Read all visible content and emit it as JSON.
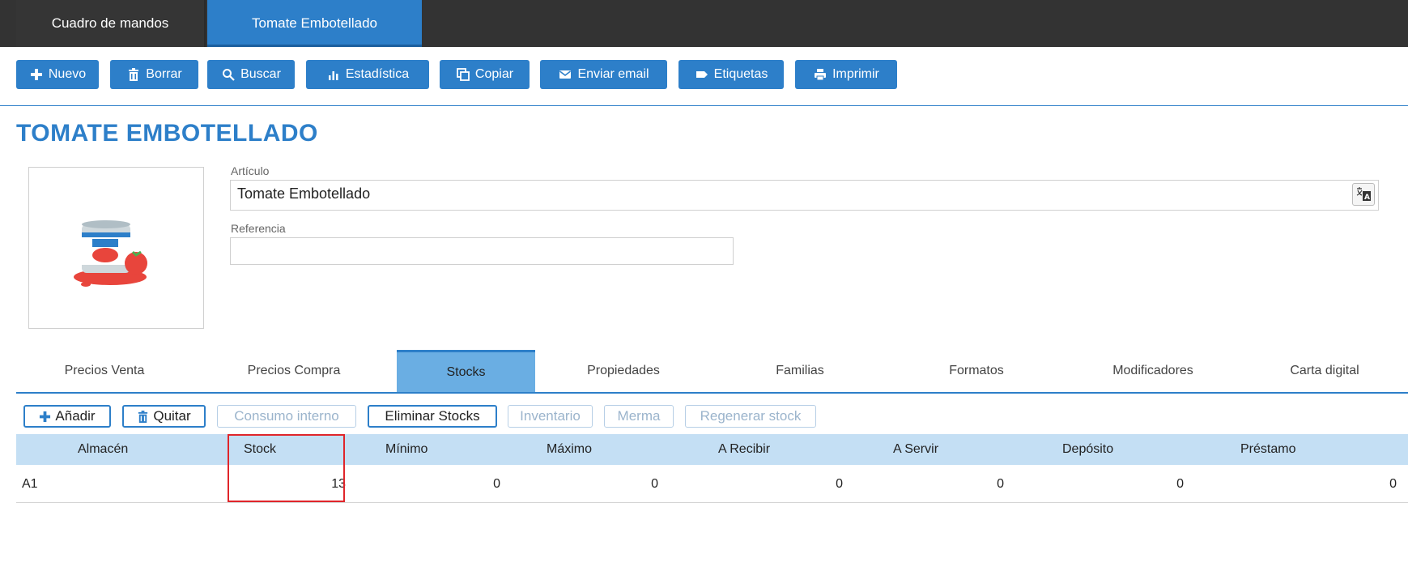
{
  "top_tabs": [
    {
      "label": "Cuadro de mandos"
    },
    {
      "label": "Tomate Embotellado"
    }
  ],
  "toolbar": {
    "nuevo": "Nuevo",
    "borrar": "Borrar",
    "buscar": "Buscar",
    "estadistica": "Estadística",
    "copiar": "Copiar",
    "enviar_email": "Enviar email",
    "etiquetas": "Etiquetas",
    "imprimir": "Imprimir"
  },
  "page_title": "TOMATE EMBOTELLADO",
  "product_image_icon": "tomato-soup-can-icon",
  "fields": {
    "articulo_label": "Artículo",
    "articulo_value": "Tomate Embotellado",
    "referencia_label": "Referencia",
    "referencia_value": ""
  },
  "section_tabs": [
    {
      "label": "Precios Venta"
    },
    {
      "label": "Precios Compra"
    },
    {
      "label": "Stocks"
    },
    {
      "label": "Propiedades"
    },
    {
      "label": "Familias"
    },
    {
      "label": "Formatos"
    },
    {
      "label": "Modificadores"
    },
    {
      "label": "Carta digital"
    }
  ],
  "active_section_tab": "Stocks",
  "stock_actions": {
    "anadir": "Añadir",
    "quitar": "Quitar",
    "consumo_interno": "Consumo interno",
    "eliminar_stocks": "Eliminar Stocks",
    "inventario": "Inventario",
    "merma": "Merma",
    "regenerar_stock": "Regenerar stock"
  },
  "table": {
    "columns": [
      "Almacén",
      "Stock",
      "Mínimo",
      "Máximo",
      "A Recibir",
      "A Servir",
      "Depósito",
      "Préstamo"
    ],
    "rows": [
      [
        "A1",
        "13",
        "0",
        "0",
        "0",
        "0",
        "0",
        "0"
      ]
    ]
  },
  "colors": {
    "accent": "#2d7fc9",
    "topbar": "#333333",
    "table_header": "#c4dff4",
    "highlight": "#e0252a"
  }
}
